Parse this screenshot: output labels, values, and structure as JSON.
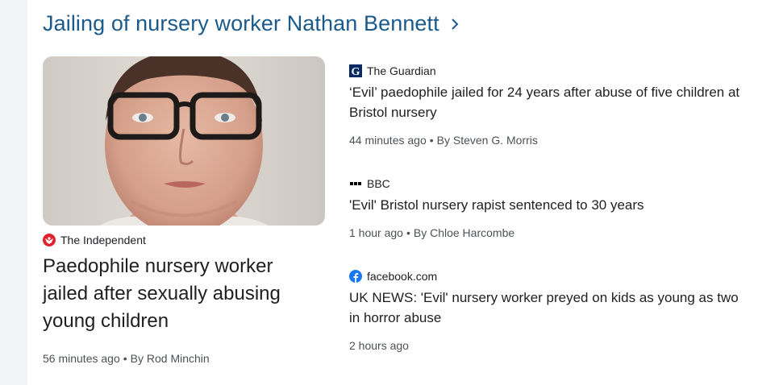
{
  "section": {
    "title": "Jailing of nursery worker Nathan Bennett",
    "chevron_icon": "chevron-right-icon"
  },
  "featured": {
    "image_alt": "photo of a man with glasses",
    "source": "The Independent",
    "source_icon": "independent-eagle-icon",
    "source_color": "#e0222b",
    "headline": "Paedophile nursery worker jailed after sexually abusing young children",
    "time": "56 minutes ago",
    "author": "By Rod Minchin"
  },
  "stories": [
    {
      "source": "The Guardian",
      "source_icon": "guardian-g-icon",
      "source_color": "#052962",
      "headline": "‘Evil’ paedophile jailed for 24 years after abuse of five children at Bristol nursery",
      "time": "44 minutes ago",
      "author": "By Steven G. Morris"
    },
    {
      "source": "BBC",
      "source_icon": "bbc-icon",
      "source_color": "#000000",
      "headline": "'Evil' Bristol nursery rapist sentenced to 30 years",
      "time": "1 hour ago",
      "author": "By Chloe Harcombe"
    },
    {
      "source": "facebook.com",
      "source_icon": "facebook-icon",
      "source_color": "#1877f2",
      "headline": "UK NEWS: 'Evil' nursery worker preyed on kids as young as two in horror abuse",
      "time": "2 hours ago",
      "author": ""
    }
  ],
  "colors": {
    "header_link": "#1a5a8c",
    "meta_text": "#4d5156",
    "headline_text": "#1f1f1f"
  }
}
